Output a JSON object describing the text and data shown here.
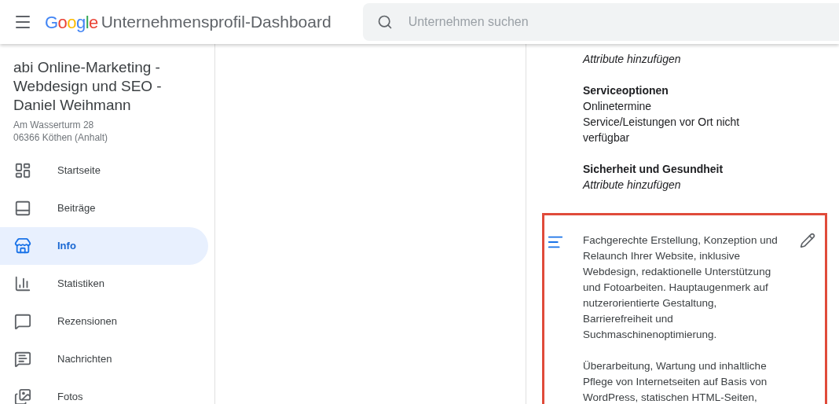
{
  "header": {
    "logo": [
      "G",
      "o",
      "o",
      "g",
      "l",
      "e"
    ],
    "title": "Unternehmensprofil-Dashboard",
    "search": {
      "placeholder": "Unternehmen suchen"
    }
  },
  "business": {
    "name": "abi Online-Marketing - Webdesign und SEO - Daniel Weihmann",
    "address": [
      "Am Wasserturm 28",
      "06366 Köthen (Anhalt)"
    ]
  },
  "sidebar": {
    "items": [
      {
        "label": "Startseite",
        "kind": "dashboard",
        "selected": false
      },
      {
        "label": "Beiträge",
        "kind": "posts",
        "selected": false
      },
      {
        "label": "Info",
        "kind": "store",
        "selected": true
      },
      {
        "label": "Statistiken",
        "kind": "stats",
        "selected": false
      },
      {
        "label": "Rezensionen",
        "kind": "reviews",
        "selected": false
      },
      {
        "label": "Nachrichten",
        "kind": "messages",
        "selected": false
      },
      {
        "label": "Fotos",
        "kind": "photos",
        "selected": false
      }
    ]
  },
  "attributes": [
    {
      "values": [
        "Attribute hinzufügen"
      ],
      "placeholder": true
    },
    {
      "title": "Serviceoptionen",
      "values": [
        "Onlinetermine",
        "Service/Leistungen vor Ort nicht verfügbar"
      ],
      "placeholder": false
    },
    {
      "title": "Sicherheit und Gesundheit",
      "values": [
        "Attribute hinzufügen"
      ],
      "placeholder": true
    }
  ],
  "description": {
    "highlighted": true,
    "paragraphs": [
      "Fachgerechte Erstellung, Konzeption und Relaunch Ihrer Website, inklusive Webdesign, redaktionelle Unterstützung und Fotoarbeiten. Hauptaugenmerk auf nutzerorientierte Gestaltung, Barrierefreiheit und Suchmaschinenoptimierung.",
      "Überarbeitung, Wartung und inhaltliche Pflege von Internetseiten auf Basis von WordPress, statischen HTML-Seiten,"
    ]
  }
}
